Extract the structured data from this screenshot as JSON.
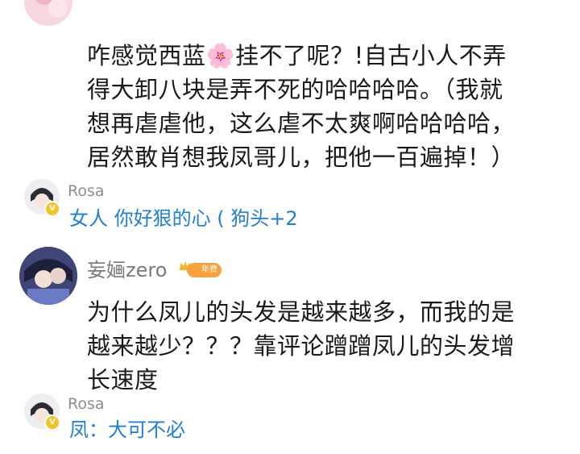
{
  "top_comment": {
    "lines": [
      "咋感觉西蓝🌸挂不了呢？!自古小人不弄",
      "得大卸八块是弄不死的哈哈哈哈。（我就",
      "想再虐虐他，这么虐不太爽啊哈哈哈哈，",
      "居然敢肖想我凤哥儿，把他一百遍掉！）"
    ]
  },
  "reply1": {
    "name": "Rosa",
    "body": "女人 你好狠的心 ( 狗头+2"
  },
  "comment2": {
    "username": "妄婳zero",
    "tag": "年费",
    "lines": [
      "为什么凤儿的头发是越来越多，而我的是",
      "越来越少？？？靠评论蹭蹭凤儿的头发增",
      "长速度"
    ]
  },
  "reply2": {
    "name": "Rosa",
    "body": "凤：大可不必"
  }
}
